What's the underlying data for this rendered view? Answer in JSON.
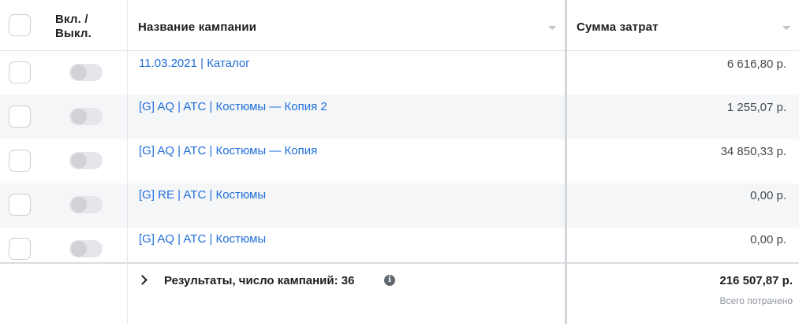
{
  "header": {
    "toggle_line1": "Вкл. /",
    "toggle_line2": "Выкл.",
    "campaign_name": "Название кампании",
    "cost": "Сумма затрат"
  },
  "rows": [
    {
      "name": "11.03.2021 | Каталог",
      "cost": "6 616,80 р.",
      "enabled": false
    },
    {
      "name": "[G] AQ | ATC | Костюмы — Копия 2",
      "cost": "1 255,07 р.",
      "enabled": false
    },
    {
      "name": "[G] AQ | ATC | Костюмы — Копия",
      "cost": "34 850,33 р.",
      "enabled": false
    },
    {
      "name": "[G] RE | ATC | Костюмы",
      "cost": "0,00 р.",
      "enabled": false
    },
    {
      "name": "[G] AQ | ATC | Костюмы",
      "cost": "0,00 р.",
      "enabled": false
    }
  ],
  "footer": {
    "results_label": "Результаты, число кампаний: 36",
    "total": "216 507,87 р.",
    "total_caption": "Всего потрачено"
  },
  "colors": {
    "link": "#216fdb",
    "alt_row": "#f5f6f7",
    "border": "#dadde1"
  },
  "icons": {
    "sort": "chevron-down-icon",
    "expand": "chevron-right-icon",
    "info": "info-icon"
  }
}
